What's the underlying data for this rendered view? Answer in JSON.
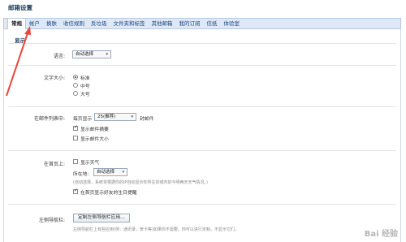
{
  "title": "邮箱设置",
  "tabs": [
    "常规",
    "帐户",
    "换肤",
    "收信规则",
    "反垃圾",
    "文件夹和标签",
    "其他邮箱",
    "我的订阅",
    "信纸",
    "体验室"
  ],
  "section": "显示",
  "language": {
    "label": "语言:",
    "value": "自动选择"
  },
  "font_size": {
    "label": "文字大小:",
    "options": [
      "标准",
      "中号",
      "大号"
    ],
    "selected": 0
  },
  "mail_list": {
    "label": "在邮件列表中:",
    "per_page_prefix": "每页显示",
    "per_page_value": "25(推荐)",
    "per_page_suffix": "封邮件",
    "show_summary": "显示邮件摘要",
    "show_size": "显示邮件大小"
  },
  "homepage": {
    "label": "在首页上:",
    "show_weather": "显示天气",
    "location_label": "所在地:",
    "location_value": "自动选择",
    "note": "(自动选择，系统将根据你的IP自动显示你所在的城市的今明两天天气情况。)",
    "birthday": "在首页显示好友的生日提醒"
  },
  "left_nav": {
    "label": "左侧导航栏:",
    "button": "定制左侧导航栏应用...",
    "note": "左侧导航栏上有些应用(例：通讯录，贺卡等)如果你不需要，你可以进行定制，不显示它们。"
  },
  "watermark": "Bai 经验",
  "colors": {
    "accent": "#1a4780",
    "tab_bg": "#dfe8f6",
    "arrow": "#e8483d"
  }
}
